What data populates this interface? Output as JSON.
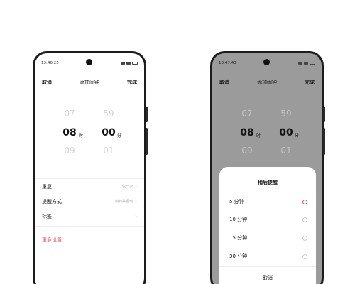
{
  "left": {
    "status_time": "13:46:25",
    "nav": {
      "cancel": "取消",
      "title": "添加闹钟",
      "done": "完成"
    },
    "picker": {
      "hours": [
        "07",
        "08",
        "09"
      ],
      "minutes": [
        "59",
        "00",
        "01"
      ],
      "hour_unit": "时",
      "minute_unit": "分"
    },
    "settings": [
      {
        "label": "重复",
        "value": "仅一次"
      },
      {
        "label": "提醒方式",
        "value": "响铃并振动"
      },
      {
        "label": "标签",
        "value": ""
      }
    ],
    "more_settings": "更多设置"
  },
  "right": {
    "status_time": "13:47:43",
    "nav": {
      "cancel": "取消",
      "title": "添加闹钟",
      "done": "完成"
    },
    "picker": {
      "hours": [
        "07",
        "08",
        "09"
      ],
      "minutes": [
        "59",
        "00",
        "01"
      ],
      "hour_unit": "时",
      "minute_unit": "分"
    },
    "sheet": {
      "title": "稍后提醒",
      "options": [
        "5 分钟",
        "10 分钟",
        "15 分钟",
        "30 分钟"
      ],
      "selected_index": 0,
      "cancel": "取消"
    }
  },
  "colors": {
    "accent": "#e0515a",
    "dim_overlay": "#9b9b9b"
  }
}
